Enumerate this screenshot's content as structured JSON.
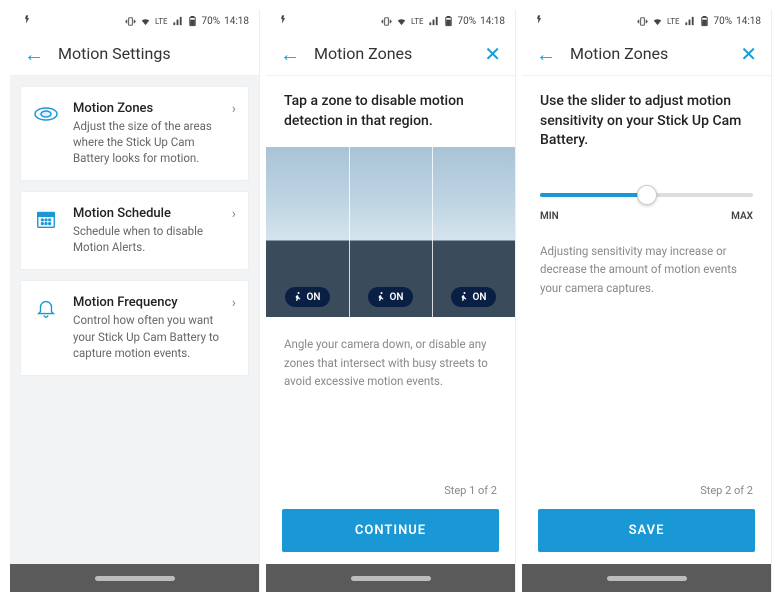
{
  "status": {
    "battery_pct": "70%",
    "time": "14:18",
    "lte": "LTE"
  },
  "screen1": {
    "title": "Motion Settings",
    "items": [
      {
        "title": "Motion Zones",
        "desc": "Adjust the size of the areas where the Stick Up Cam Battery looks for motion."
      },
      {
        "title": "Motion Schedule",
        "desc": "Schedule when to disable Motion Alerts."
      },
      {
        "title": "Motion Frequency",
        "desc": "Control how often you want your Stick Up Cam Battery to capture motion events."
      }
    ]
  },
  "screen2": {
    "title": "Motion Zones",
    "instructions": "Tap a zone to disable motion detection in that region.",
    "zone_label": "ON",
    "hint": "Angle your camera down, or disable any zones that intersect with busy streets to avoid excessive motion events.",
    "step": "Step 1 of 2",
    "button": "CONTINUE"
  },
  "screen3": {
    "title": "Motion Zones",
    "instructions": "Use the slider to adjust motion sensitivity on your Stick Up Cam Battery.",
    "min": "MIN",
    "max": "MAX",
    "hint": "Adjusting sensitivity may increase or decrease the amount of motion events your camera captures.",
    "step": "Step 2 of 2",
    "button": "SAVE"
  },
  "colors": {
    "accent": "#1998d5"
  }
}
